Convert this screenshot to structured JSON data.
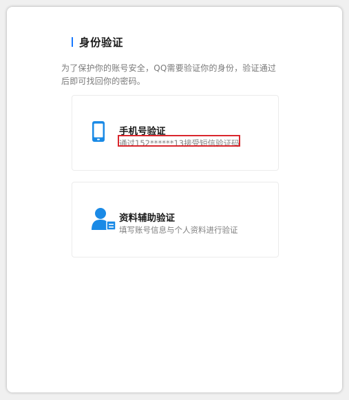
{
  "header": {
    "title": "身份验证",
    "description": "为了保护你的账号安全，QQ需要验证你的身份，验证通过后即可找回你的密码。"
  },
  "options": [
    {
      "title": "手机号验证",
      "subtitle": "通过152******13接受短信验证码",
      "icon": "mobile-phone-icon"
    },
    {
      "title": "资料辅助验证",
      "subtitle": "填写账号信息与个人资料进行验证",
      "icon": "user-id-card-icon"
    }
  ],
  "colors": {
    "accent": "#1677ff",
    "icon_blue": "#1a8ae6",
    "highlight": "#d9262c"
  }
}
